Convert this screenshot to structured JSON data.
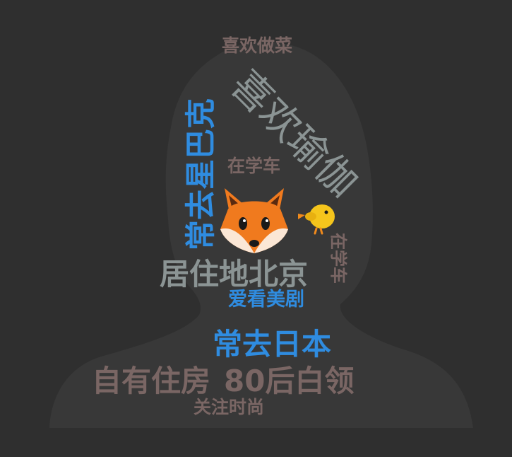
{
  "colors": {
    "background": "#2f2f2f",
    "silhouette": "#383838",
    "brown": "#7a6664",
    "gray": "#8b9494",
    "blue": "#2f8ce0",
    "fox_orange": "#f07a1e",
    "chick_yellow": "#f5c51c"
  },
  "tags": {
    "cooking": "喜欢做菜",
    "yoga": "喜欢瑜伽",
    "starbucks": "常去星巴克",
    "learning_drive_1": "在学车",
    "learning_drive_2": "在学车",
    "beijing": "居住地北京",
    "tv_series": "爱看美剧",
    "japan": "常去日本",
    "own_house": "自有住房",
    "post80": "80后白领",
    "fashion": "关注时尚"
  },
  "icons": [
    "fox-icon",
    "chick-icon"
  ]
}
